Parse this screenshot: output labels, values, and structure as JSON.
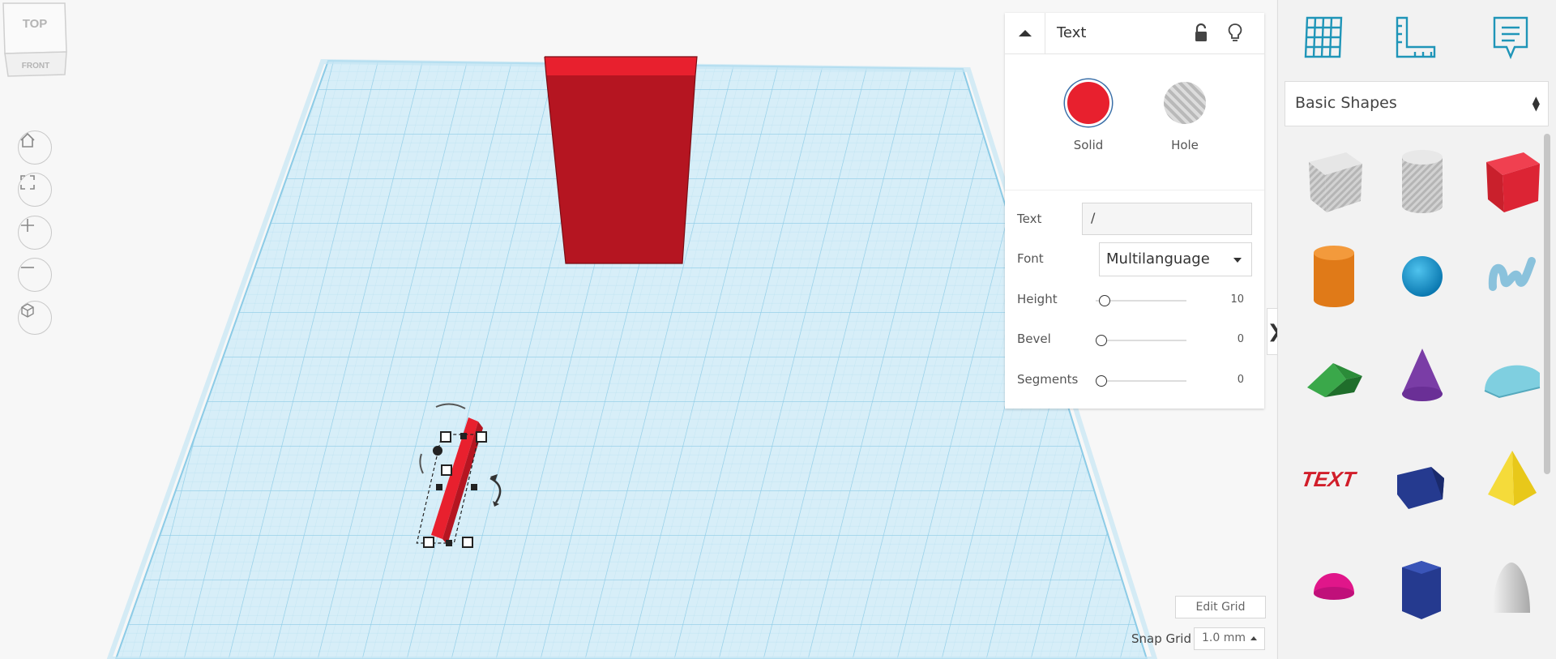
{
  "viewcube": {
    "top_label": "TOP",
    "front_label": "FRONT"
  },
  "nav_controls": [
    "home-view",
    "fit-view",
    "zoom-in",
    "zoom-out",
    "perspective"
  ],
  "inspector": {
    "title": "Text",
    "solid_label": "Solid",
    "hole_label": "Hole",
    "solid_color": "#e8202e",
    "text_label": "Text",
    "text_value": "/",
    "font_label": "Font",
    "font_value": "Multilanguage",
    "height_label": "Height",
    "height_value": "10",
    "bevel_label": "Bevel",
    "bevel_value": "0",
    "segments_label": "Segments",
    "segments_value": "0"
  },
  "workplane": {
    "edit_grid_label": "Edit Grid",
    "snap_grid_label": "Snap Grid",
    "snap_grid_value": "1.0 mm",
    "grid_color": "#9fd3ec"
  },
  "right_panel": {
    "icons": [
      "workplane-grid-icon",
      "ruler-icon",
      "notes-icon"
    ],
    "shape_category": "Basic Shapes",
    "shapes": [
      {
        "name": "box-hole"
      },
      {
        "name": "cylinder-hole"
      },
      {
        "name": "box"
      },
      {
        "name": "cylinder"
      },
      {
        "name": "sphere"
      },
      {
        "name": "scribble"
      },
      {
        "name": "roof"
      },
      {
        "name": "cone"
      },
      {
        "name": "round-roof"
      },
      {
        "name": "text"
      },
      {
        "name": "wedge"
      },
      {
        "name": "pyramid"
      },
      {
        "name": "half-sphere"
      },
      {
        "name": "polygon"
      },
      {
        "name": "paraboloid"
      }
    ]
  }
}
